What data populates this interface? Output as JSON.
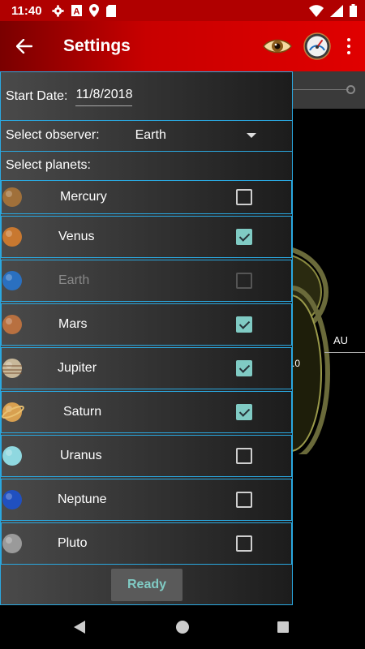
{
  "status_bar": {
    "time": "11:40",
    "icons": [
      "gear-icon",
      "font-icon",
      "location-icon",
      "sd-card-icon"
    ],
    "right_icons": [
      "wifi-icon",
      "signal-icon",
      "battery-icon"
    ],
    "font_icon_letter": "A"
  },
  "app_bar": {
    "title": "Settings",
    "back_icon": "arrow-back-icon",
    "actions": [
      "eye-icon",
      "gauge-icon",
      "more-vert-icon"
    ]
  },
  "background": {
    "au_label": "AU",
    "scale_label": ".0"
  },
  "dialog": {
    "start_date_label": "Start Date:",
    "start_date_value": "11/8/2018",
    "observer_label": "Select observer:",
    "observer_value": "Earth",
    "planets_label": "Select planets:",
    "planets": [
      {
        "name": "Mercury",
        "checked": false,
        "disabled": false,
        "color": "#a0703a"
      },
      {
        "name": "Venus",
        "checked": true,
        "disabled": false,
        "color": "#c87830"
      },
      {
        "name": "Earth",
        "checked": false,
        "disabled": true,
        "color": "#2a70c0"
      },
      {
        "name": "Mars",
        "checked": true,
        "disabled": false,
        "color": "#b87040"
      },
      {
        "name": "Jupiter",
        "checked": true,
        "disabled": false,
        "color": "#c8b89a"
      },
      {
        "name": "Saturn",
        "checked": true,
        "disabled": false,
        "color": "#d8a050"
      },
      {
        "name": "Uranus",
        "checked": false,
        "disabled": false,
        "color": "#8fd8e0"
      },
      {
        "name": "Neptune",
        "checked": false,
        "disabled": false,
        "color": "#2050c0"
      },
      {
        "name": "Pluto",
        "checked": false,
        "disabled": false,
        "color": "#9a9a9a"
      }
    ],
    "ready_label": "Ready"
  },
  "colors": {
    "accent": "#2aa8e0",
    "checkbox_checked": "#80cbc4",
    "app_bar": "#c80000"
  }
}
